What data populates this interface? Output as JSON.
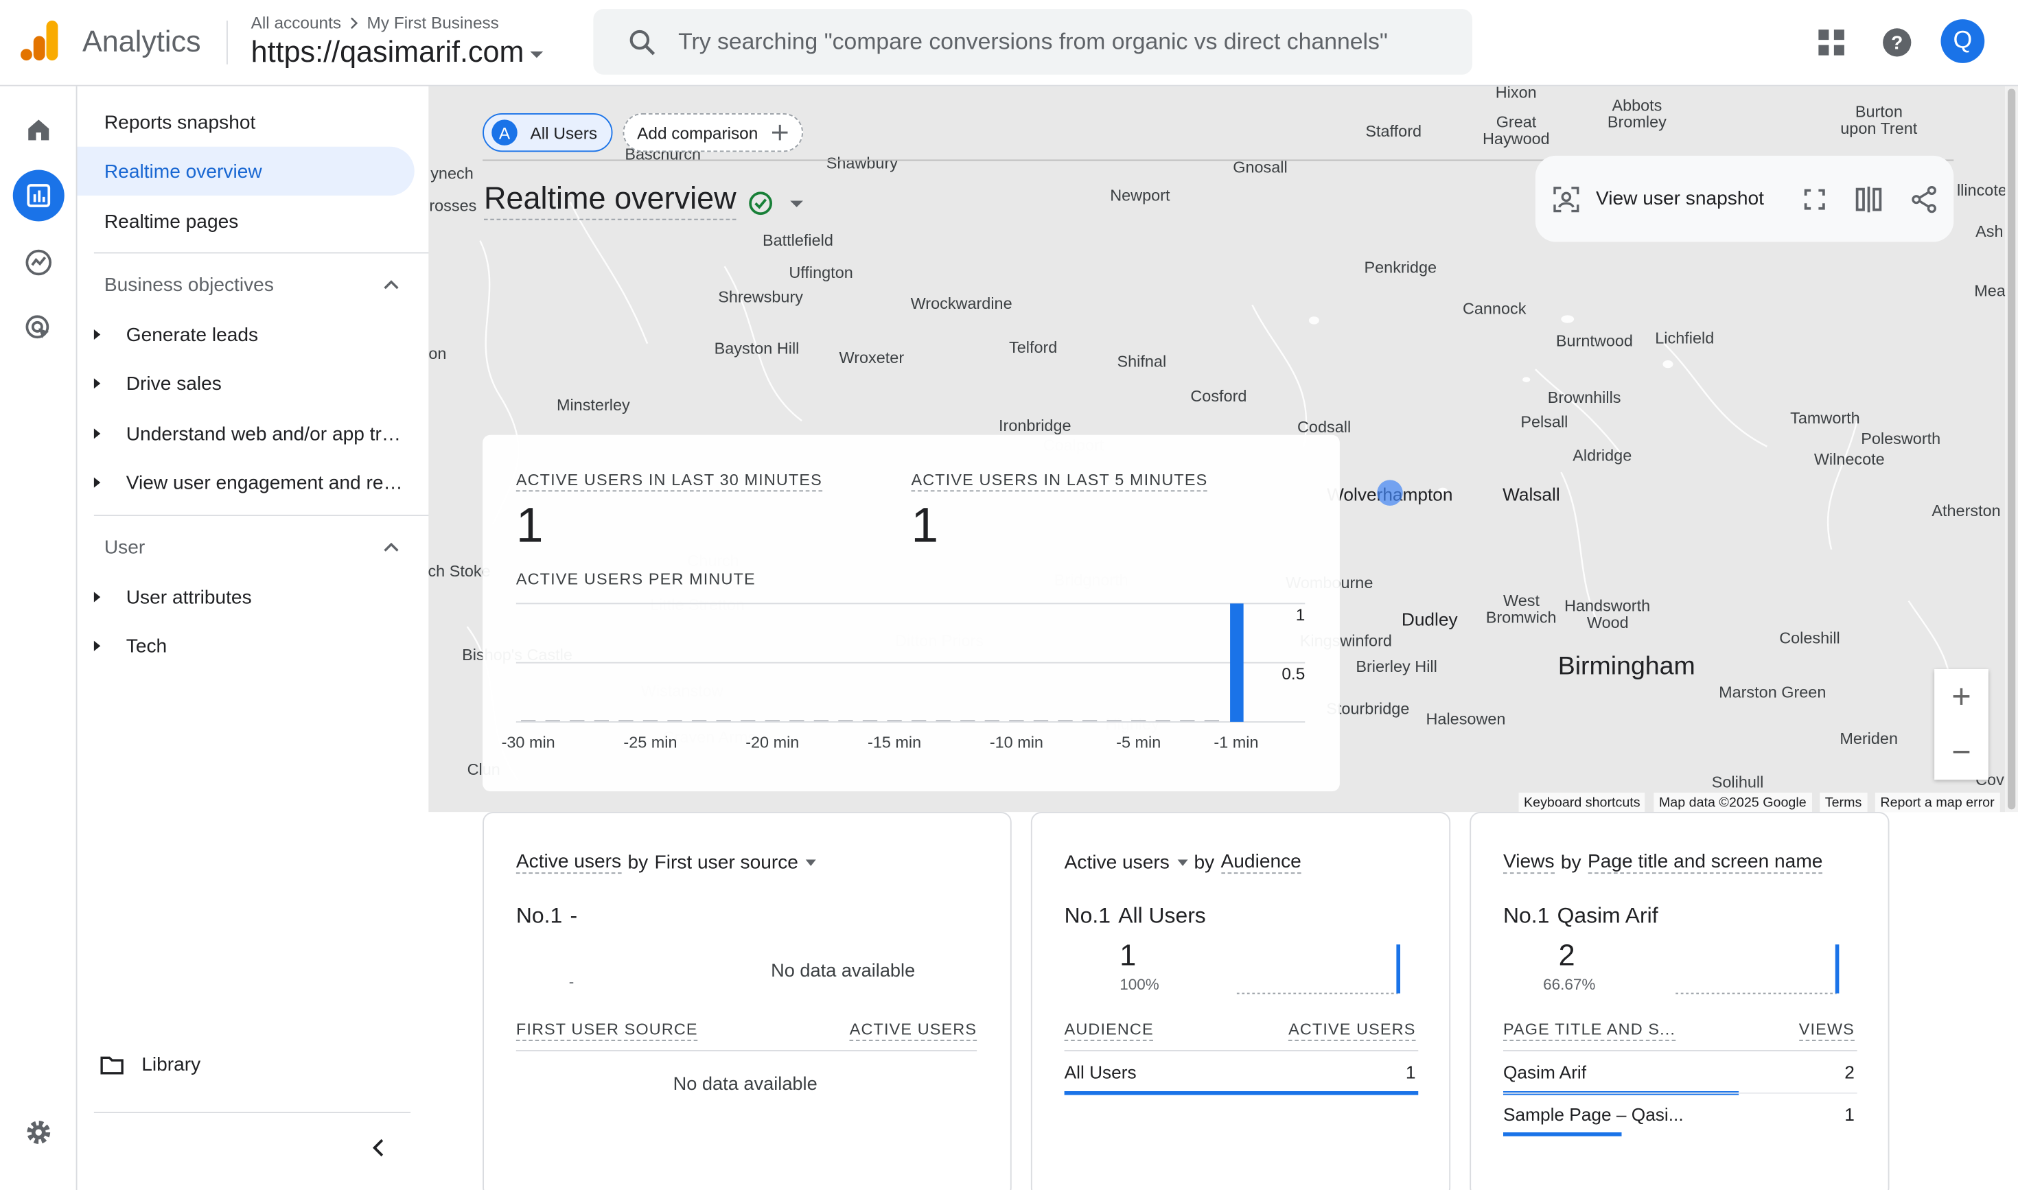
{
  "app": {
    "product": "Analytics",
    "breadcrumb_account": "All accounts",
    "breadcrumb_property": "My First Business",
    "property_name": "https://qasimarif.com",
    "search_placeholder": "Try searching \"compare conversions from organic vs direct channels\"",
    "avatar_initial": "Q"
  },
  "nav": {
    "items": [
      {
        "label": "Reports snapshot"
      },
      {
        "label": "Realtime overview",
        "active": true
      },
      {
        "label": "Realtime pages"
      }
    ],
    "groups": [
      {
        "label": "Business objectives",
        "children": [
          "Generate leads",
          "Drive sales",
          "Understand web and/or app traffic",
          "View user engagement and retention"
        ]
      },
      {
        "label": "User",
        "children": [
          "User attributes",
          "Tech"
        ]
      }
    ],
    "library_label": "Library"
  },
  "toolbar": {
    "comparison_chip": "All Users",
    "comparison_chip_letter": "A",
    "add_comparison": "Add comparison",
    "page_title": "Realtime overview",
    "view_user_snapshot": "View user snapshot"
  },
  "map": {
    "places": [
      {
        "name": "Hixon",
        "x": 1178,
        "y": 72,
        "cls": ""
      },
      {
        "name": "Abbots",
        "x": 1272,
        "y": 82,
        "cls": ""
      },
      {
        "name": "Bromley",
        "x": 1272,
        "y": 95,
        "cls": ""
      },
      {
        "name": "Burton",
        "x": 1460,
        "y": 87,
        "cls": ""
      },
      {
        "name": "upon Trent",
        "x": 1460,
        "y": 100,
        "cls": ""
      },
      {
        "name": "Great",
        "x": 1178,
        "y": 95,
        "cls": ""
      },
      {
        "name": "Haywood",
        "x": 1178,
        "y": 108,
        "cls": ""
      },
      {
        "name": "Stafford",
        "x": 1083,
        "y": 102,
        "cls": ""
      },
      {
        "name": "Baschurch",
        "x": 515,
        "y": 120,
        "cls": ""
      },
      {
        "name": "Shawbury",
        "x": 670,
        "y": 127,
        "cls": ""
      },
      {
        "name": "Gnosall",
        "x": 979,
        "y": 130,
        "cls": ""
      },
      {
        "name": "ynech",
        "x": 351,
        "y": 135,
        "cls": ""
      },
      {
        "name": "Newport",
        "x": 886,
        "y": 152,
        "cls": ""
      },
      {
        "name": "llincote",
        "x": 1540,
        "y": 148,
        "cls": ""
      },
      {
        "name": "rosses",
        "x": 352,
        "y": 160,
        "cls": ""
      },
      {
        "name": "Ash",
        "x": 1546,
        "y": 180,
        "cls": ""
      },
      {
        "name": "Battlefield",
        "x": 620,
        "y": 187,
        "cls": ""
      },
      {
        "name": "Penkridge",
        "x": 1088,
        "y": 208,
        "cls": ""
      },
      {
        "name": "Uffington",
        "x": 638,
        "y": 212,
        "cls": ""
      },
      {
        "name": "Mea",
        "x": 1546,
        "y": 226,
        "cls": ""
      },
      {
        "name": "Shrewsbury",
        "x": 591,
        "y": 231,
        "cls": ""
      },
      {
        "name": "Wrockwardine",
        "x": 747,
        "y": 236,
        "cls": ""
      },
      {
        "name": "Cannock",
        "x": 1161,
        "y": 240,
        "cls": ""
      },
      {
        "name": "Burntwood",
        "x": 1239,
        "y": 265,
        "cls": ""
      },
      {
        "name": "Lichfield",
        "x": 1309,
        "y": 263,
        "cls": ""
      },
      {
        "name": "Telford",
        "x": 803,
        "y": 270,
        "cls": ""
      },
      {
        "name": "Bayston Hill",
        "x": 588,
        "y": 271,
        "cls": ""
      },
      {
        "name": "on",
        "x": 340,
        "y": 275,
        "cls": ""
      },
      {
        "name": "Wroxeter",
        "x": 677,
        "y": 278,
        "cls": ""
      },
      {
        "name": "Shifnal",
        "x": 887,
        "y": 281,
        "cls": ""
      },
      {
        "name": "Cosford",
        "x": 947,
        "y": 308,
        "cls": ""
      },
      {
        "name": "Brownhills",
        "x": 1231,
        "y": 309,
        "cls": ""
      },
      {
        "name": "Minsterley",
        "x": 461,
        "y": 315,
        "cls": ""
      },
      {
        "name": "Tamworth",
        "x": 1418,
        "y": 325,
        "cls": ""
      },
      {
        "name": "Pelsall",
        "x": 1200,
        "y": 328,
        "cls": ""
      },
      {
        "name": "Ironbridge",
        "x": 804,
        "y": 331,
        "cls": ""
      },
      {
        "name": "Codsall",
        "x": 1029,
        "y": 332,
        "cls": ""
      },
      {
        "name": "Polesworth",
        "x": 1477,
        "y": 341,
        "cls": ""
      },
      {
        "name": "Coalport",
        "x": 834,
        "y": 346,
        "cls": "faint"
      },
      {
        "name": "Aldridge",
        "x": 1245,
        "y": 354,
        "cls": ""
      },
      {
        "name": "Wilnecote",
        "x": 1437,
        "y": 357,
        "cls": ""
      },
      {
        "name": "Wolverhampton",
        "x": 1080,
        "y": 384,
        "cls": "med"
      },
      {
        "name": "Walsall",
        "x": 1190,
        "y": 384,
        "cls": "med"
      },
      {
        "name": "Atherston",
        "x": 1528,
        "y": 397,
        "cls": ""
      },
      {
        "name": "ch Stoke",
        "x": 357,
        "y": 444,
        "cls": ""
      },
      {
        "name": "Wombourne",
        "x": 1033,
        "y": 453,
        "cls": ""
      },
      {
        "name": "Church",
        "x": 554,
        "y": 436,
        "cls": "faint"
      },
      {
        "name": "Bridgnorth",
        "x": 848,
        "y": 451,
        "cls": "faint"
      },
      {
        "name": "West",
        "x": 1182,
        "y": 467,
        "cls": ""
      },
      {
        "name": "Bromwich",
        "x": 1182,
        "y": 480,
        "cls": ""
      },
      {
        "name": "Handsworth",
        "x": 1249,
        "y": 471,
        "cls": ""
      },
      {
        "name": "Wood",
        "x": 1249,
        "y": 484,
        "cls": ""
      },
      {
        "name": "Dudley",
        "x": 1111,
        "y": 481,
        "cls": "med"
      },
      {
        "name": "Little Stretton",
        "x": 542,
        "y": 470,
        "cls": "faint"
      },
      {
        "name": "Kingswinford",
        "x": 1046,
        "y": 498,
        "cls": ""
      },
      {
        "name": "Coleshill",
        "x": 1406,
        "y": 496,
        "cls": ""
      },
      {
        "name": "Ditton Priors",
        "x": 730,
        "y": 498,
        "cls": "faint"
      },
      {
        "name": "Bishop's Castle",
        "x": 402,
        "y": 509,
        "cls": ""
      },
      {
        "name": "Brierley Hill",
        "x": 1085,
        "y": 518,
        "cls": ""
      },
      {
        "name": "Birmingham",
        "x": 1264,
        "y": 518,
        "cls": "big"
      },
      {
        "name": "Wistanstow",
        "x": 530,
        "y": 537,
        "cls": "faint"
      },
      {
        "name": "Marston Green",
        "x": 1377,
        "y": 538,
        "cls": ""
      },
      {
        "name": "Stourbridge",
        "x": 1063,
        "y": 551,
        "cls": ""
      },
      {
        "name": "Halesowen",
        "x": 1139,
        "y": 559,
        "cls": ""
      },
      {
        "name": "Highley",
        "x": 880,
        "y": 563,
        "cls": "faint"
      },
      {
        "name": "Craven Arms",
        "x": 551,
        "y": 573,
        "cls": "faint"
      },
      {
        "name": "Meriden",
        "x": 1452,
        "y": 574,
        "cls": ""
      },
      {
        "name": "Clun",
        "x": 376,
        "y": 598,
        "cls": ""
      },
      {
        "name": "Solihull",
        "x": 1350,
        "y": 608,
        "cls": ""
      },
      {
        "name": "Cov",
        "x": 1546,
        "y": 606,
        "cls": ""
      }
    ],
    "attribution": [
      "Keyboard shortcuts",
      "Map data ©2025 Google",
      "Terms",
      "Report a map error"
    ]
  },
  "realtime": {
    "label_30": "ACTIVE USERS IN LAST 30 MINUTES",
    "value_30": "1",
    "label_5": "ACTIVE USERS IN LAST 5 MINUTES",
    "value_5": "1",
    "per_minute_label": "ACTIVE USERS PER MINUTE"
  },
  "chart_data": {
    "type": "bar",
    "x_tick_labels": [
      "-30 min",
      "-25 min",
      "-20 min",
      "-15 min",
      "-10 min",
      "-5 min",
      "-1 min"
    ],
    "y_tick_labels": [
      "1",
      "0.5"
    ],
    "ylim": [
      0,
      1
    ],
    "values": [
      0,
      0,
      0,
      0,
      0,
      0,
      0,
      0,
      0,
      0,
      0,
      0,
      0,
      0,
      0,
      0,
      0,
      0,
      0,
      0,
      0,
      0,
      0,
      0,
      0,
      0,
      0,
      0,
      0,
      1
    ],
    "bar_color": "#1a73e8"
  },
  "cards": [
    {
      "metric": "Active users",
      "by": "by",
      "dimension": "First user source",
      "rank": "No.1",
      "top_name": "-",
      "top_value": "-",
      "spark_empty_text": "No data available",
      "col1": "FIRST USER SOURCE",
      "col2": "ACTIVE USERS",
      "rows": [],
      "table_empty_text": "No data available"
    },
    {
      "metric": "Active users",
      "by": "by",
      "dimension": "Audience",
      "rank": "No.1",
      "top_name": "All Users",
      "top_value": "1",
      "top_pct": "100%",
      "col1": "AUDIENCE",
      "col2": "ACTIVE USERS",
      "rows": [
        {
          "name": "All Users",
          "value": "1",
          "share": 1.0
        }
      ]
    },
    {
      "metric": "Views",
      "by": "by",
      "dimension": "Page title and screen name",
      "rank": "No.1",
      "top_name": "Qasim Arif",
      "top_value": "2",
      "top_pct": "66.67%",
      "col1": "PAGE TITLE AND S...",
      "col2": "VIEWS",
      "rows": [
        {
          "name": "Qasim Arif",
          "value": "2",
          "share": 0.6667
        },
        {
          "name": "Sample Page – Qasi...",
          "value": "1",
          "share": 0.3333
        }
      ]
    }
  ],
  "colors": {
    "accent": "#1a73e8",
    "accent_light": "#e8f0fe",
    "logo_orange": "#f9ab00",
    "logo_dark_orange": "#e37400",
    "check_green": "#188038",
    "map_dot": "#4285f4"
  }
}
